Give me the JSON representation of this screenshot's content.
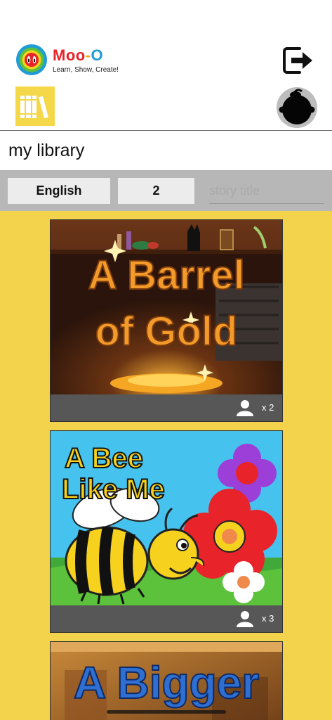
{
  "brand": {
    "title_part1": "Moo",
    "title_dash": "-",
    "title_part2": "O",
    "tagline": "Learn, Show, Create!"
  },
  "header": {
    "logout_icon": "logout-icon",
    "library_icon": "books-icon",
    "avatar_icon": "child-silhouette-icon"
  },
  "page": {
    "title": "my library"
  },
  "filters": {
    "language": "English",
    "count": "2",
    "search_placeholder": "story title"
  },
  "books": [
    {
      "title_line1": "A Barrel",
      "title_line2": "of Gold",
      "readers": "x 2"
    },
    {
      "title_line1": "A Bee",
      "title_line2": "Like Me",
      "readers": "x 3"
    },
    {
      "title_line1": "A Bigger"
    }
  ],
  "colors": {
    "shelf_bg": "#f3d34b",
    "filter_bar_bg": "#b7b7b7",
    "button_bg": "#ececec",
    "card_footer": "#575757"
  }
}
